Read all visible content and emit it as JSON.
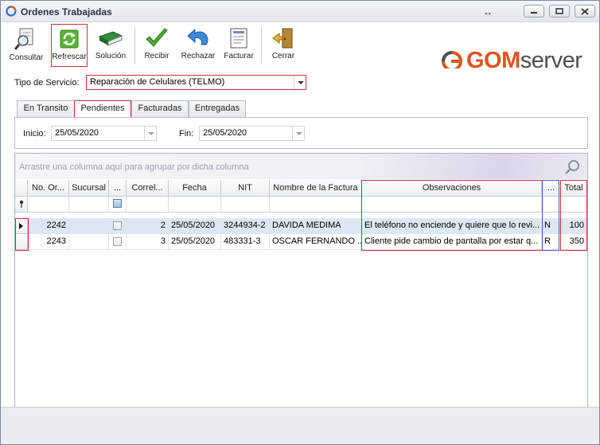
{
  "window": {
    "title": "Ordenes Trabajadas"
  },
  "toolbar": {
    "consultar": "Consultar",
    "refrescar": "Refrescar",
    "solucion": "Solución",
    "recibir": "Recibir",
    "rechazar": "Rechazar",
    "facturar": "Facturar",
    "cerrar": "Cerrar"
  },
  "logo": {
    "part1": "GOM",
    "part2": "server"
  },
  "filters": {
    "tipo_label": "Tipo de Servicio:",
    "tipo_value": "Reparación de Celulares (TELMO)",
    "inicio_label": "Inicio:",
    "inicio_value": "25/05/2020",
    "fin_label": "Fin:",
    "fin_value": "25/05/2020"
  },
  "tabs": [
    "En Transito",
    "Pendientes",
    "Facturadas",
    "Entregadas"
  ],
  "active_tab": "Pendientes",
  "grid": {
    "group_prompt": "Arrastre una columna aquí para agrupar por dicha columna",
    "columns": [
      "No. Or...",
      "Sucursal",
      "...",
      "Correl...",
      "Fecha",
      "NIT",
      "Nombre de la Factura",
      "Observaciones",
      "...",
      "Total"
    ],
    "rows": [
      {
        "no_orden": "2242",
        "sucursal": "",
        "correl": "2",
        "fecha": "25/05/2020",
        "nit": "3244934-2",
        "nombre": "DAVIDA MEDIMA",
        "observaciones": "El teléfono no enciende y quiere que lo revi...",
        "flag": "N",
        "total": "100"
      },
      {
        "no_orden": "2243",
        "sucursal": "",
        "correl": "3",
        "fecha": "25/05/2020",
        "nit": "483331-3",
        "nombre": "OSCAR FERNANDO ...",
        "observaciones": "Cliente pide cambio de pantalla por estar q...",
        "flag": "R",
        "total": "350"
      }
    ]
  },
  "colors": {
    "accent_red": "#c8323c",
    "brand_orange": "#e0541e",
    "selected_row": "#dde7f4"
  }
}
